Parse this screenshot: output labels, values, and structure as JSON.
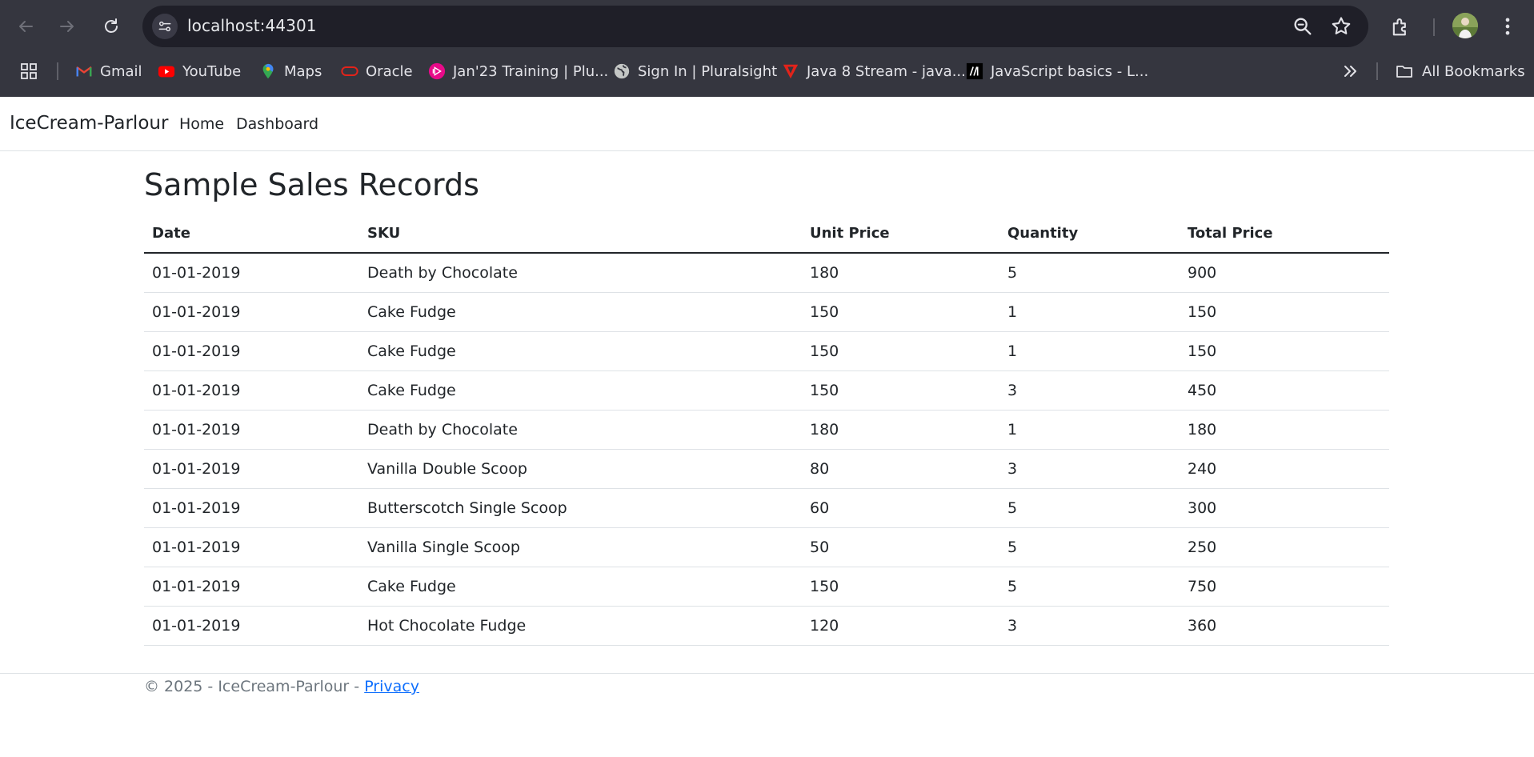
{
  "browser": {
    "url": "localhost:44301",
    "bookmarks": [
      {
        "label": "Gmail",
        "icon": "gmail-icon"
      },
      {
        "label": "YouTube",
        "icon": "youtube-icon"
      },
      {
        "label": "Maps",
        "icon": "maps-icon"
      },
      {
        "label": "Oracle",
        "icon": "oracle-icon"
      },
      {
        "label": "Jan'23 Training | Plu...",
        "icon": "pluralsight-icon"
      },
      {
        "label": "Sign In | Pluralsight",
        "icon": "globe-icon"
      },
      {
        "label": "Java 8 Stream - java...",
        "icon": "java-icon"
      },
      {
        "label": "JavaScript basics - L...",
        "icon": "mdn-icon"
      }
    ],
    "all_bookmarks_label": "All Bookmarks",
    "colors": {
      "chrome_bg": "#35363f",
      "omnibox_bg": "#1f1f28",
      "text": "#e3e3e8"
    }
  },
  "navbar": {
    "brand": "IceCream-Parlour",
    "links": [
      "Home",
      "Dashboard"
    ]
  },
  "main": {
    "title": "Sample Sales Records",
    "columns": [
      "Date",
      "SKU",
      "Unit Price",
      "Quantity",
      "Total Price"
    ],
    "rows": [
      [
        "01-01-2019",
        "Death by Chocolate",
        "180",
        "5",
        "900"
      ],
      [
        "01-01-2019",
        "Cake Fudge",
        "150",
        "1",
        "150"
      ],
      [
        "01-01-2019",
        "Cake Fudge",
        "150",
        "1",
        "150"
      ],
      [
        "01-01-2019",
        "Cake Fudge",
        "150",
        "3",
        "450"
      ],
      [
        "01-01-2019",
        "Death by Chocolate",
        "180",
        "1",
        "180"
      ],
      [
        "01-01-2019",
        "Vanilla Double Scoop",
        "80",
        "3",
        "240"
      ],
      [
        "01-01-2019",
        "Butterscotch Single Scoop",
        "60",
        "5",
        "300"
      ],
      [
        "01-01-2019",
        "Vanilla Single Scoop",
        "50",
        "5",
        "250"
      ],
      [
        "01-01-2019",
        "Cake Fudge",
        "150",
        "5",
        "750"
      ],
      [
        "01-01-2019",
        "Hot Chocolate Fudge",
        "120",
        "3",
        "360"
      ]
    ]
  },
  "footer": {
    "text": "© 2025 - IceCream-Parlour - ",
    "privacy_link": "Privacy",
    "link_color": "#0d6efd"
  }
}
